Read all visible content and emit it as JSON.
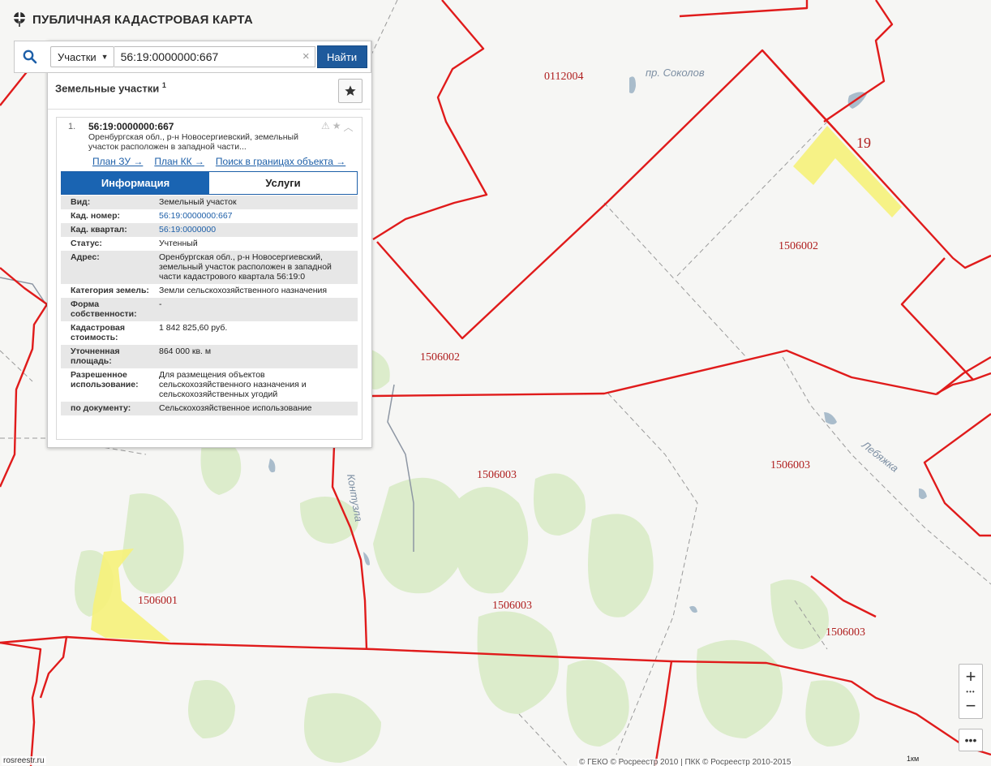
{
  "app": {
    "title": "ПУБЛИЧНАЯ КАДАСТРОВАЯ КАРТА"
  },
  "search": {
    "type_label": "Участки",
    "query": "56:19:0000000:667",
    "button_label": "Найти",
    "clear_icon": "×"
  },
  "results": {
    "heading": "Земельные участки",
    "count": "1",
    "item": {
      "index": "1.",
      "cad_number": "56:19:0000000:667",
      "description": "Оренбургская обл., р-н Новосергиевский, земельный участок расположен в западной части...",
      "links": [
        "План ЗУ →",
        "План КК →",
        "Поиск в границах объекта →"
      ],
      "tabs": [
        "Информация",
        "Услуги"
      ],
      "rows": [
        {
          "k": "Вид:",
          "v": "Земельный участок",
          "link": false
        },
        {
          "k": "Кад. номер:",
          "v": "56:19:0000000:667",
          "link": true
        },
        {
          "k": "Кад. квартал:",
          "v": "56:19:0000000",
          "link": true
        },
        {
          "k": "Статус:",
          "v": "Учтенный",
          "link": false
        },
        {
          "k": "Адрес:",
          "v": "Оренбургская обл., р-н Новосергиевский, земельный участок расположен в западной части кадастрового квартала 56:19:0",
          "link": false
        },
        {
          "k": "Категория земель:",
          "v": "Земли сельскохозяйственного назначения",
          "link": false
        },
        {
          "k": "Форма собственности:",
          "v": "-",
          "link": false
        },
        {
          "k": "Кадастровая стоимость:",
          "v": "1 842 825,60 руб.",
          "link": false
        },
        {
          "k": "Уточненная площадь:",
          "v": "864 000 кв. м",
          "link": false
        },
        {
          "k": "Разрешенное использование:",
          "v": "Для размещения объектов сельскохозяйственного назначения и сельскохозяйственных угодий",
          "link": false
        },
        {
          "k": "по документу:",
          "v": "Сельскохозяйственное использование",
          "link": false
        }
      ]
    }
  },
  "map": {
    "labels": {
      "q0112004": "0112004",
      "q1506002a": "1506002",
      "q1506002b": "1506002",
      "q1506003a": "1506003",
      "q1506003b": "1506003",
      "q1506003c": "1506003",
      "q1506003d": "1506003",
      "q1506001": "1506001",
      "parcel19": "19",
      "sokolov": "пр. Соколов",
      "lebyazhka": "Лебяжка",
      "kontuzla": "Контузла"
    },
    "colors": {
      "boundary": "#e01b1b",
      "highlight": "#f6f27a",
      "forest": "#d9ebc6",
      "water": "#9fb6c8"
    }
  },
  "controls": {
    "zoom_in": "+",
    "zoom_out": "−",
    "dots": "•••",
    "more": "•••"
  },
  "footer": {
    "site": "rosreestr.ru",
    "copyright": "© ГЕКО © Росреестр 2010 | ПКК © Росреестр 2010-2015",
    "scale": "1км"
  }
}
